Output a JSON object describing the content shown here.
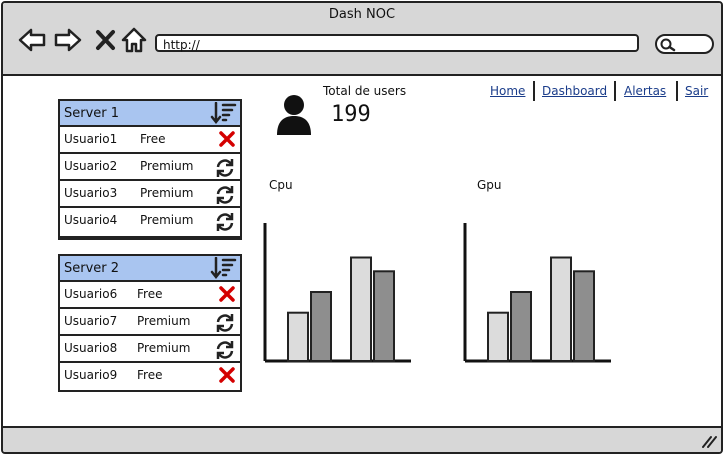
{
  "window": {
    "title": "Dash NOC"
  },
  "browser": {
    "url": "http://"
  },
  "header": {
    "total_label": "Total de users",
    "total_value": "199",
    "menu": [
      "Home",
      "Dashboard",
      "Alertas",
      "Sair"
    ]
  },
  "servers": [
    {
      "name": "Server 1",
      "rows": [
        {
          "user": "Usuario1",
          "plan": "Free",
          "action": "delete-icon"
        },
        {
          "user": "Usuario2",
          "plan": "Premium",
          "action": "refresh-icon"
        },
        {
          "user": "Usuario3",
          "plan": "Premium",
          "action": "refresh-icon"
        },
        {
          "user": "Usuario4",
          "plan": "Premium",
          "action": "refresh-icon"
        }
      ]
    },
    {
      "name": "Server 2",
      "rows": [
        {
          "user": "Usuario6",
          "plan": "Free",
          "action": "delete-icon"
        },
        {
          "user": "Usuario7",
          "plan": "Premium",
          "action": "refresh-icon"
        },
        {
          "user": "Usuario8",
          "plan": "Premium",
          "action": "refresh-icon"
        },
        {
          "user": "Usuario9",
          "plan": "Free",
          "action": "delete-icon"
        }
      ]
    }
  ],
  "colors": {
    "header_blue": "#a9c5f0",
    "delete_red": "#d40000",
    "bar_light": "#dcdcdc",
    "bar_dark": "#8e8e8e",
    "chrome_gray": "#d7d7d7"
  },
  "chart_data": [
    {
      "type": "bar",
      "title": "Cpu",
      "series": [
        {
          "values": [
            3.5,
            5,
            7.5,
            6.5
          ]
        }
      ],
      "ylim": [
        0,
        10
      ],
      "grid": false
    },
    {
      "type": "bar",
      "title": "Gpu",
      "series": [
        {
          "values": [
            3.5,
            5,
            7.5,
            6.5
          ]
        }
      ],
      "ylim": [
        0,
        10
      ],
      "grid": false
    }
  ]
}
